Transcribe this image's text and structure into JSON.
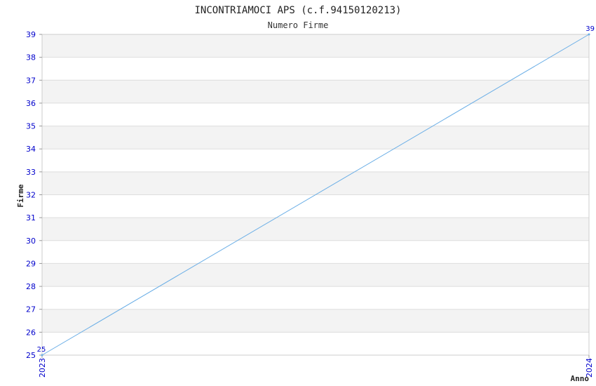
{
  "chart_data": {
    "type": "line",
    "title": "INCONTRIAMOCI APS (c.f.94150120213)",
    "subtitle": "Numero Firme",
    "xlabel": "Anno",
    "ylabel": "Firme",
    "categories": [
      "2023",
      "2024"
    ],
    "series": [
      {
        "values": [
          25,
          39
        ]
      }
    ],
    "ylim": [
      25,
      39
    ],
    "yticks": [
      25,
      26,
      27,
      28,
      29,
      30,
      31,
      32,
      33,
      34,
      35,
      36,
      37,
      38,
      39
    ],
    "data_labels": [
      "25",
      "39"
    ],
    "grid": true,
    "colors": {
      "line": "#6aaee6",
      "band": "#f3f3f3",
      "grid": "#dddddd",
      "tick_text": "#0000cc"
    }
  }
}
